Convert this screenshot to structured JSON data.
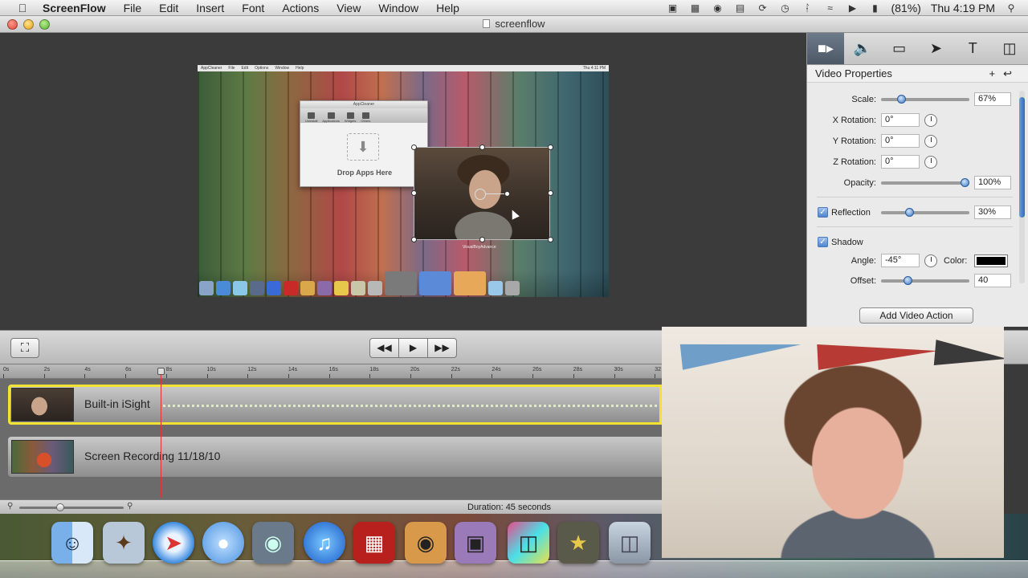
{
  "menubar": {
    "app_name": "ScreenFlow",
    "menus": [
      "File",
      "Edit",
      "Insert",
      "Font",
      "Actions",
      "View",
      "Window",
      "Help"
    ],
    "battery": "(81%)",
    "clock": "Thu 4:19 PM"
  },
  "window": {
    "title": "screenflow"
  },
  "canvas": {
    "mini_menubar": [
      "AppCleaner",
      "File",
      "Edit",
      "Options",
      "Window",
      "Help"
    ],
    "mini_clock": "Thu 4:11 PM",
    "mini_window_title": "AppCleaner",
    "mini_toolbar": [
      "Uninstall",
      "Applications",
      "Widgets",
      "Others"
    ],
    "drop_label": "Drop Apps Here",
    "pip_label": "VisualBoyAdvance"
  },
  "inspector": {
    "tabs": [
      "video-camera",
      "audio",
      "screen",
      "callout",
      "text",
      "media"
    ],
    "section_title": "Video Properties",
    "scale": {
      "label": "Scale:",
      "value": "67%",
      "level": 0.2
    },
    "x_rotation": {
      "label": "X Rotation:",
      "value": "0°"
    },
    "y_rotation": {
      "label": "Y Rotation:",
      "value": "0°"
    },
    "z_rotation": {
      "label": "Z Rotation:",
      "value": "0°"
    },
    "opacity": {
      "label": "Opacity:",
      "value": "100%",
      "level": 1.0
    },
    "reflection": {
      "label": "Reflection",
      "value": "30%",
      "level": 0.3,
      "checked": true
    },
    "shadow": {
      "label": "Shadow",
      "checked": true
    },
    "angle": {
      "label": "Angle:",
      "value": "-45°"
    },
    "color": {
      "label": "Color:",
      "value": "#000000"
    },
    "offset": {
      "label": "Offset:",
      "value": "40",
      "level": 0.28
    },
    "add_action_label": "Add Video Action"
  },
  "toolbar": {
    "crop_icon": "crop-icon",
    "rewind_icon": "rewind-icon",
    "play_icon": "play-icon",
    "forward_icon": "fast-forward-icon"
  },
  "timeline": {
    "ruler_ticks": [
      "0s",
      "2s",
      "4s",
      "6s",
      "8s",
      "10s",
      "12s",
      "14s",
      "16s",
      "18s",
      "20s",
      "22s",
      "24s",
      "26s",
      "28s",
      "30s",
      "32"
    ],
    "tracks": [
      {
        "name": "Built-in iSight",
        "selected": true
      },
      {
        "name": "Screen Recording 11/18/10",
        "selected": false
      }
    ],
    "duration": "Duration: 45 seconds"
  },
  "dock": {
    "apps": [
      "finder",
      "mail",
      "safari",
      "ichat",
      "facetime",
      "itunes",
      "photo-booth",
      "iphoto",
      "imovie",
      "screenflow",
      "imovie-star",
      "trash"
    ]
  }
}
